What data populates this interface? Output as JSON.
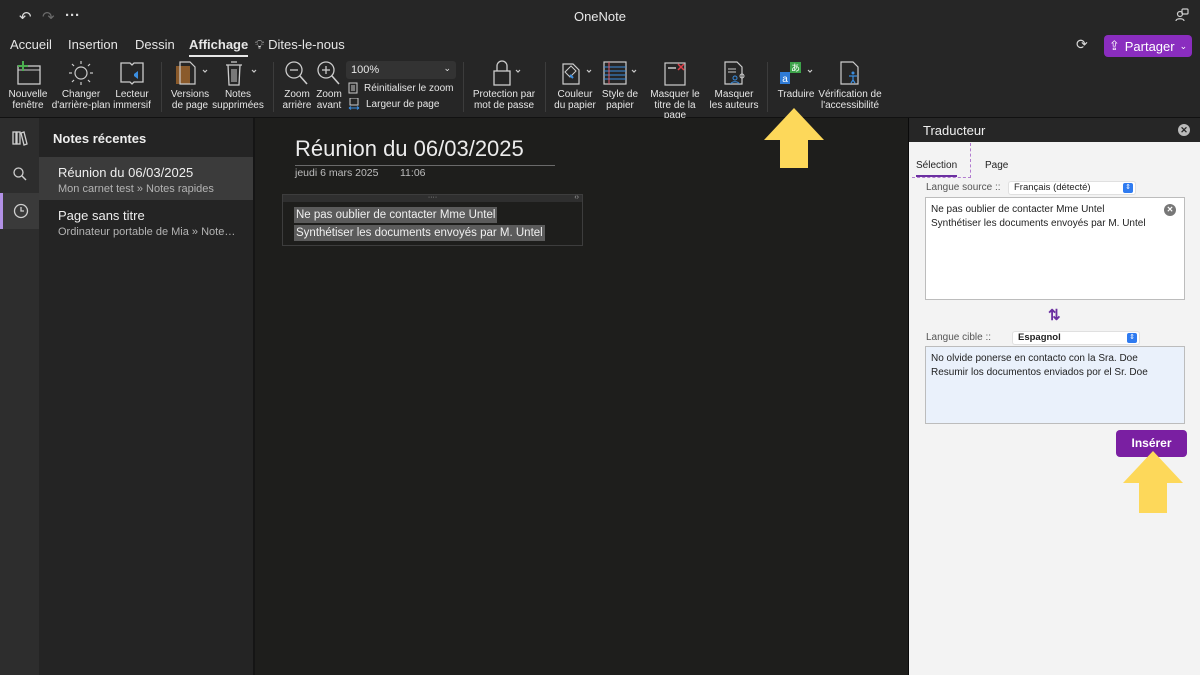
{
  "app": {
    "title": "OneNote"
  },
  "titlebar": {
    "more_label": "···"
  },
  "tabs": [
    {
      "label": "Accueil",
      "active": false
    },
    {
      "label": "Insertion",
      "active": false
    },
    {
      "label": "Dessin",
      "active": false
    },
    {
      "label": "Affichage",
      "active": true
    },
    {
      "label": "Dites-le-nous",
      "active": false
    }
  ],
  "share": {
    "label": "Partager",
    "color": "#8a2dbf"
  },
  "ribbon": {
    "new_window": "Nouvelle fenêtre",
    "new_window_l1": "Nouvelle",
    "new_window_l2": "fenêtre",
    "background_l1": "Changer",
    "background_l2": "d'arrière-plan",
    "reader_l1": "Lecteur",
    "reader_l2": "immersif",
    "versions_l1": "Versions",
    "versions_l2": "de page",
    "deleted_l1": "Notes",
    "deleted_l2": "supprimées",
    "zoom_out_l1": "Zoom",
    "zoom_out_l2": "arrière",
    "zoom_in_l1": "Zoom",
    "zoom_in_l2": "avant",
    "zoom_level": "100%",
    "reset_zoom": "Réinitialiser le zoom",
    "page_width": "Largeur de page",
    "password_l1": "Protection par",
    "password_l2": "mot de passe",
    "paper_color_l1": "Couleur",
    "paper_color_l2": "du papier",
    "paper_style_l1": "Style de",
    "paper_style_l2": "papier",
    "hide_title_l1": "Masquer le",
    "hide_title_l2": "titre de la page",
    "hide_authors_l1": "Masquer",
    "hide_authors_l2": "les auteurs",
    "translate": "Traduire",
    "accessibility_l1": "Vérification de",
    "accessibility_l2": "l'accessibilité"
  },
  "notes_panel": {
    "title": "Notes récentes",
    "items": [
      {
        "title": "Réunion du 06/03/2025",
        "subtitle": "Mon carnet test » Notes rapides",
        "selected": true
      },
      {
        "title": "Page sans titre",
        "subtitle": "Ordinateur portable de Mia » Notes rapides",
        "selected": false
      }
    ]
  },
  "page": {
    "title": "Réunion du 06/03/2025",
    "date": "jeudi 6 mars 2025",
    "time": "11:06",
    "note_handle": "····",
    "note_resize": "‹›",
    "lines": [
      "Ne pas oublier de contacter Mme Untel",
      "Synthétiser les documents envoyés par M. Untel"
    ]
  },
  "translator": {
    "title": "Traducteur",
    "tabs": [
      {
        "label": "Sélection",
        "active": true
      },
      {
        "label": "Page",
        "active": false
      }
    ],
    "source_label": "Langue source ::",
    "source_lang": "Français (détecté)",
    "source_lines": [
      "Ne pas oublier de contacter Mme Untel",
      "Synthétiser les documents envoyés par M. Untel"
    ],
    "target_label": "Langue cible ::",
    "target_lang": "Espagnol",
    "target_lines": [
      "No olvide ponerse en contacto con la Sra. Doe",
      "Resumir los documentos enviados por el Sr. Doe"
    ],
    "insert_label": "Insérer",
    "accent": "#7a1fa2"
  },
  "annotations": {
    "arrow_color": "#fdd85a"
  }
}
